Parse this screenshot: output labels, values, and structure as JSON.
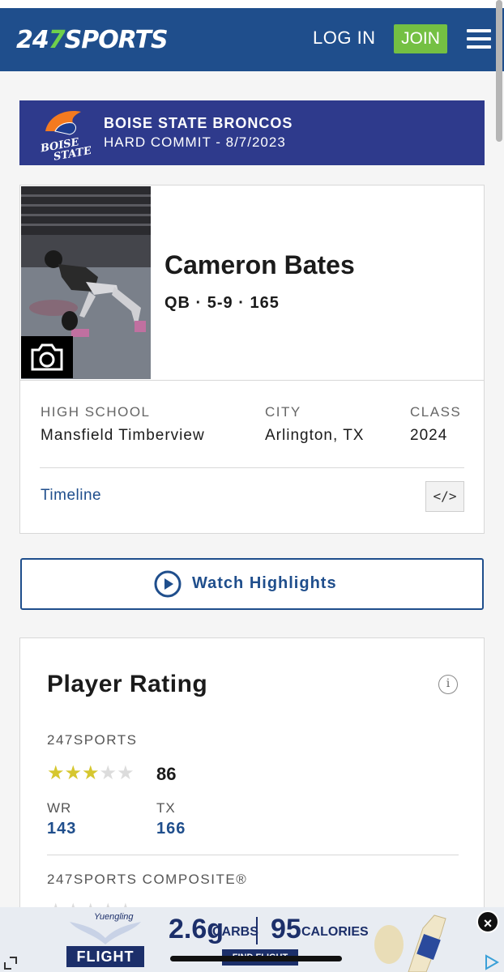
{
  "header": {
    "logo_pre": "24",
    "logo_seven": "7",
    "logo_post": "SPORTS",
    "login_label": "LOG IN",
    "join_label": "JOIN"
  },
  "commit": {
    "team": "BOISE STATE BRONCOS",
    "status": "HARD COMMIT - 8/7/2023",
    "logo_text_1": "BOISE",
    "logo_text_2": "STATE"
  },
  "player": {
    "name": "Cameron Bates",
    "position_line": "QB · 5-9 · 165",
    "high_school_label": "HIGH SCHOOL",
    "high_school": "Mansfield Timberview",
    "city_label": "CITY",
    "city": "Arlington, TX",
    "class_label": "CLASS",
    "class_year": "2024",
    "timeline_label": "Timeline",
    "embed_glyph": "</>"
  },
  "watch": {
    "label": "Watch Highlights"
  },
  "rating": {
    "title": "Player Rating",
    "info_glyph": "i",
    "source": "247SPORTS",
    "stars": 3,
    "stars_max": 5,
    "score": "86",
    "rank_pos_label": "WR",
    "rank_pos_value": "143",
    "rank_state_label": "TX",
    "rank_state_value": "166",
    "composite_label": "247SPORTS COMPOSITE®"
  },
  "ad": {
    "brand": "Yuengling",
    "product": "FLIGHT",
    "carbs_num": "2.6g",
    "carbs_label": "CARBS",
    "cal_num": "95",
    "cal_label": "CALORIES",
    "cta": "FIND FLIGHT",
    "close_glyph": "×"
  },
  "colors": {
    "header_bg": "#1f4e8c",
    "commit_bg": "#2e3a8c",
    "join_bg": "#74c043",
    "star_on": "#d6c72f",
    "link": "#1f4e8c"
  }
}
